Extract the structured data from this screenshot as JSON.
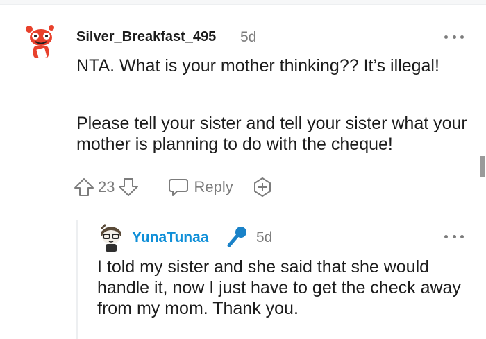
{
  "comment": {
    "username": "Silver_Breakfast_495",
    "time": "5d",
    "paragraphs": [
      "NTA. What is your mother thinking?? It’s illegal!",
      "Please tell your sister and tell your sister what your mother is planning to do with the cheque!"
    ],
    "votes": "23",
    "reply_label": "Reply",
    "icons": [
      "upvote-icon",
      "downvote-icon",
      "reply-icon",
      "award-icon",
      "more-icon"
    ]
  },
  "reply": {
    "username": "YunaTunaa",
    "flair_icon": "microphone-icon",
    "time": "5d",
    "text": "I told my sister and she said that she would handle it, now I just have to get the check away from my mom. Thank you."
  },
  "colors": {
    "text": "#1c1c1c",
    "muted": "#7c7c7c",
    "reply_username": "#0f8fd8",
    "avatar_red": "#e8412c"
  }
}
